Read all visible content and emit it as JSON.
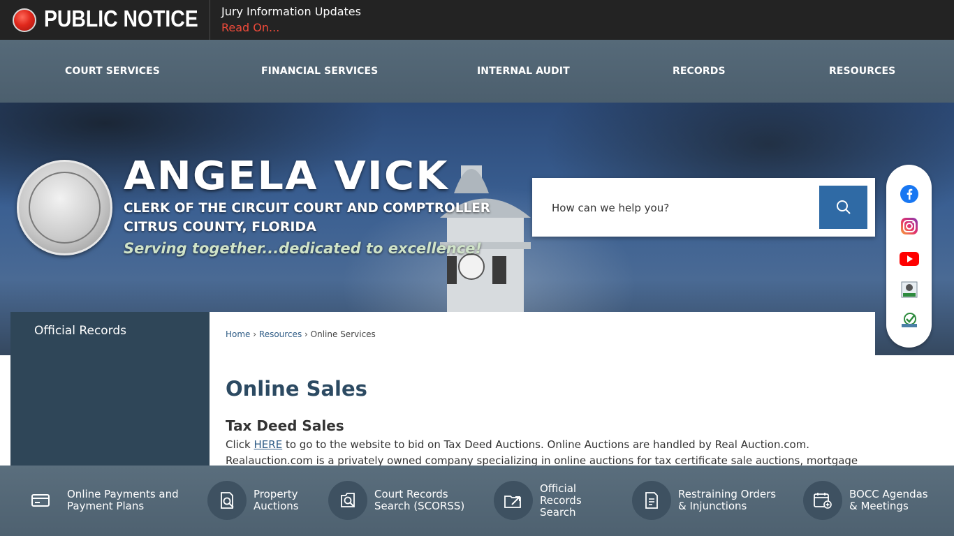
{
  "notice": {
    "title": "PUBLIC NOTICE",
    "headline": "Jury Information Updates",
    "link": "Read On..."
  },
  "nav": {
    "items": [
      {
        "label": "COURT SERVICES"
      },
      {
        "label": "FINANCIAL SERVICES"
      },
      {
        "label": "INTERNAL AUDIT"
      },
      {
        "label": "RECORDS"
      },
      {
        "label": "RESOURCES"
      }
    ]
  },
  "hero": {
    "name": "ANGELA VICK",
    "line1": "CLERK OF THE CIRCUIT COURT AND COMPTROLLER",
    "line2": "CITRUS COUNTY, FLORIDA",
    "tagline": "Serving together...dedicated to excellence!"
  },
  "search": {
    "placeholder": "How can we help you?"
  },
  "social": {
    "icons": [
      "facebook-icon",
      "instagram-icon",
      "youtube-icon",
      "newsletter-icon",
      "checklist-icon"
    ]
  },
  "sidebar": {
    "title": "Official Records"
  },
  "breadcrumb": {
    "home": "Home",
    "resources": "Resources",
    "current": "Online Services",
    "separator": "›"
  },
  "content": {
    "title": "Online Sales",
    "section_title": "Tax Deed Sales",
    "text_before_link": "Click ",
    "link_text": "HERE",
    "text_after_link": " to go to the website to bid on Tax Deed Auctions. Online Auctions are handled by Real Auction.com. Realauction.com is a privately owned company specializing in online auctions for tax certificate sale auctions, mortgage foreclosure sale auctions, tax"
  },
  "quick_links": [
    {
      "line1": "Online Payments and",
      "line2": "Payment Plans",
      "line3": ""
    },
    {
      "line1": "Property",
      "line2": "Auctions",
      "line3": ""
    },
    {
      "line1": "Court Records",
      "line2": "Search (SCORSS)",
      "line3": ""
    },
    {
      "line1": "Official",
      "line2": "Records",
      "line3": "Search"
    },
    {
      "line1": "Restraining Orders",
      "line2": "& Injunctions",
      "line3": ""
    },
    {
      "line1": "BOCC Agendas",
      "line2": "& Meetings",
      "line3": ""
    }
  ],
  "colors": {
    "accent_red": "#ef4a3a",
    "nav_bg": "#4c5f6e",
    "search_button": "#2f6aa5",
    "sidebar_bg": "#2f4658",
    "title_color": "#2c4a62"
  }
}
